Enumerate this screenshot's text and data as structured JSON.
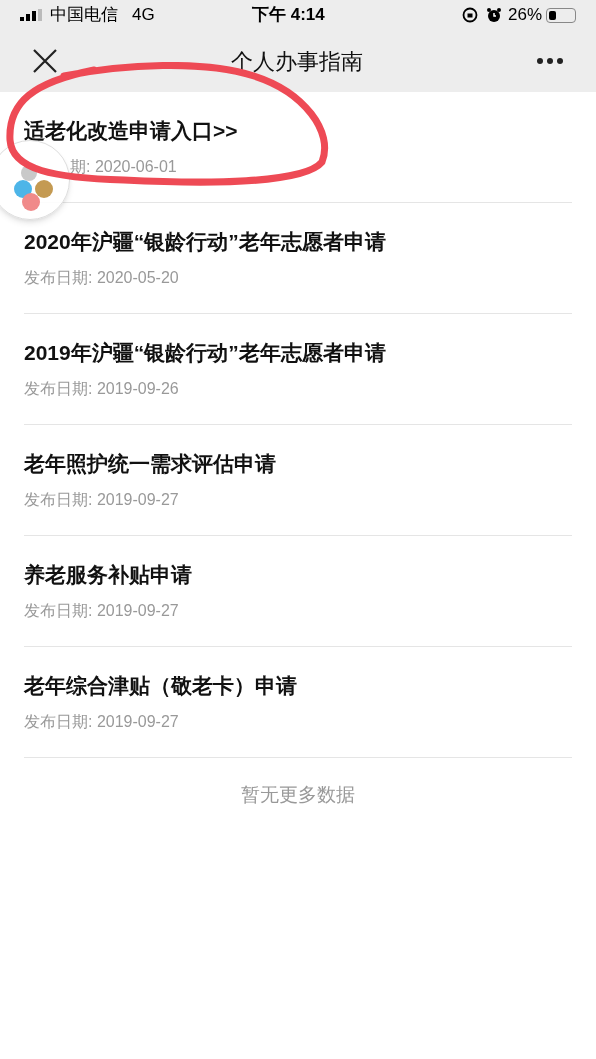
{
  "status_bar": {
    "carrier": "中国电信",
    "network": "4G",
    "time": "下午 4:14",
    "battery": "26%"
  },
  "nav_bar": {
    "title": "个人办事指南"
  },
  "items": [
    {
      "title": "适老化改造申请入口>>",
      "date": "期: 2020-06-01",
      "covered": true
    },
    {
      "title": "2020年沪疆“银龄行动”老年志愿者申请",
      "date": "发布日期: 2020-05-20",
      "covered": false
    },
    {
      "title": "2019年沪疆“银龄行动”老年志愿者申请",
      "date": "发布日期: 2019-09-26",
      "covered": false
    },
    {
      "title": "老年照护统一需求评估申请",
      "date": "发布日期: 2019-09-27",
      "covered": false
    },
    {
      "title": "养老服务补贴申请",
      "date": "发布日期: 2019-09-27",
      "covered": false
    },
    {
      "title": "老年综合津贴（敬老卡）申请",
      "date": "发布日期: 2019-09-27",
      "covered": false
    }
  ],
  "footer": "暂无更多数据"
}
